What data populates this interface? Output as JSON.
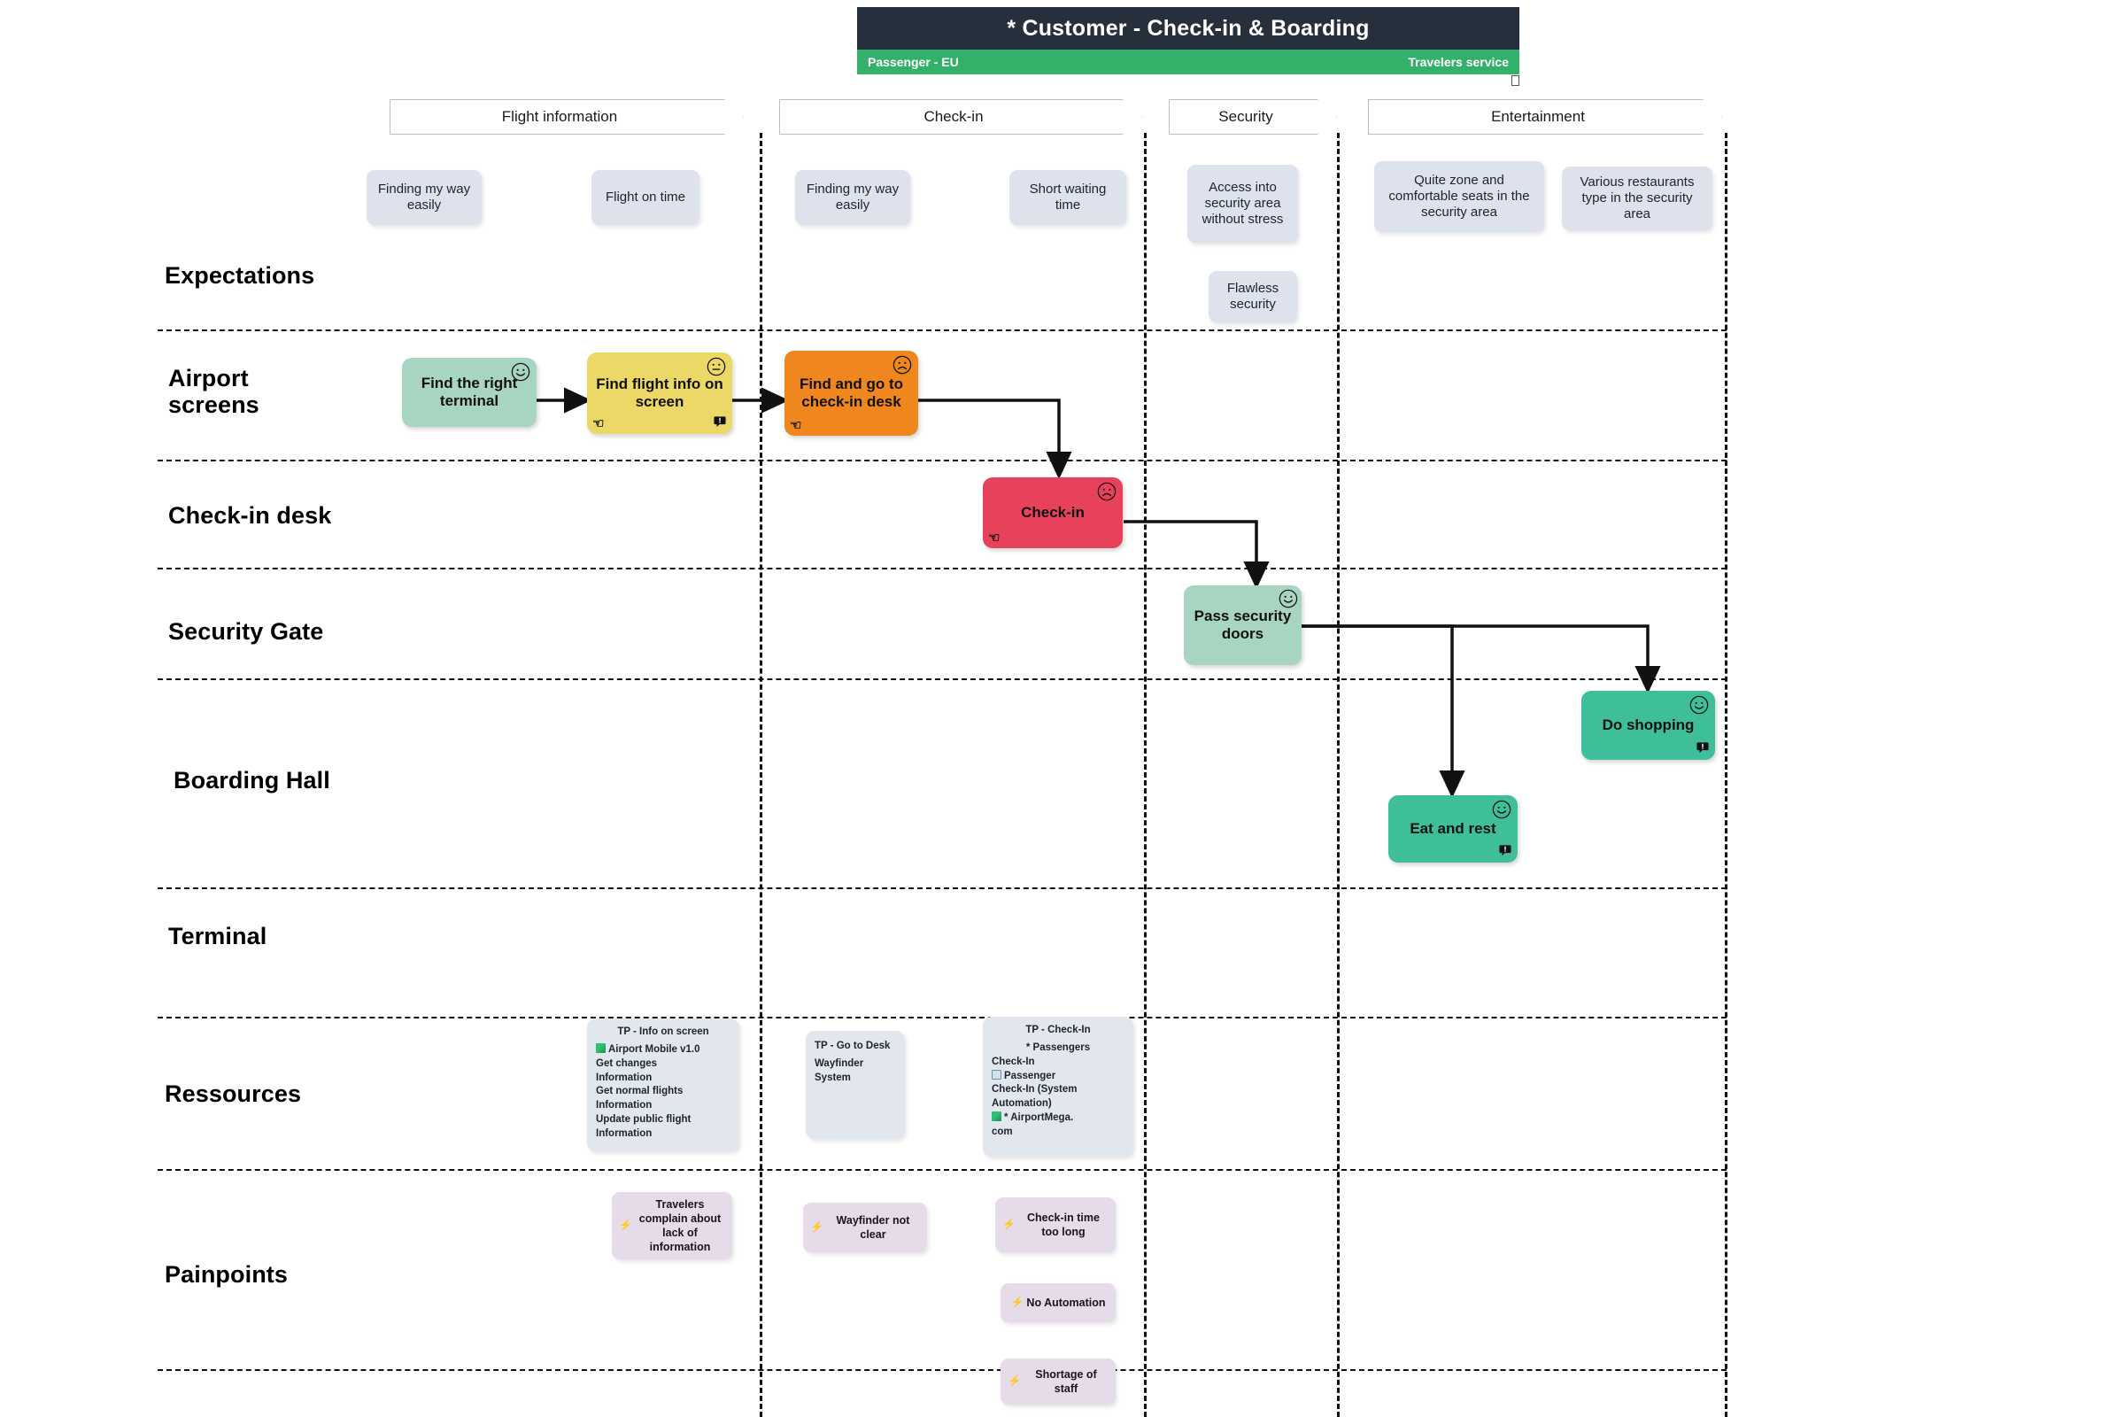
{
  "header": {
    "title": "* Customer - Check-in & Boarding",
    "persona": "Passenger - EU",
    "service": "Travelers service"
  },
  "phases": [
    {
      "label": "Flight information"
    },
    {
      "label": "Check-in"
    },
    {
      "label": "Security"
    },
    {
      "label": "Entertainment"
    }
  ],
  "rows": [
    {
      "label": "Expectations"
    },
    {
      "label": "Airport\nscreens"
    },
    {
      "label": "Check-in desk"
    },
    {
      "label": "Security Gate"
    },
    {
      "label": "Boarding Hall"
    },
    {
      "label": "Terminal"
    },
    {
      "label": "Ressources"
    },
    {
      "label": "Painpoints"
    }
  ],
  "row_labels": {
    "expectations": "Expectations",
    "airport_screens_1": "Airport",
    "airport_screens_2": "screens",
    "checkin_desk": "Check-in desk",
    "security_gate": "Security Gate",
    "boarding_hall": "Boarding Hall",
    "terminal": "Terminal",
    "ressources": "Ressources",
    "painpoints": "Painpoints"
  },
  "expectations": [
    {
      "text": "Finding my way easily",
      "phase": "Flight information"
    },
    {
      "text": "Flight on time",
      "phase": "Flight information"
    },
    {
      "text": "Finding my way easily",
      "phase": "Check-in"
    },
    {
      "text": "Short waiting time",
      "phase": "Check-in"
    },
    {
      "text": "Access into security area without stress",
      "phase": "Security"
    },
    {
      "text": "Flawless security",
      "phase": "Security"
    },
    {
      "text": "Quite zone and comfortable seats in the security area",
      "phase": "Entertainment"
    },
    {
      "text": "Various restaurants type in the security area",
      "phase": "Entertainment"
    }
  ],
  "steps": [
    {
      "label": "Find the right terminal",
      "row": "Airport screens",
      "phase": "Flight information",
      "color": "#a8d5c2",
      "sentiment": "happy",
      "has_hand": false,
      "has_comment": false
    },
    {
      "label": "Find flight info on screen",
      "row": "Airport screens",
      "phase": "Flight information",
      "color": "#ecd867",
      "sentiment": "neutral",
      "has_hand": true,
      "has_comment": true
    },
    {
      "label": "Find and go to check-in desk",
      "row": "Airport screens",
      "phase": "Check-in",
      "color": "#f0871e",
      "sentiment": "sad",
      "has_hand": true,
      "has_comment": false
    },
    {
      "label": "Check-in",
      "row": "Check-in desk",
      "phase": "Check-in",
      "color": "#e8415c",
      "sentiment": "sad",
      "has_hand": true,
      "has_comment": false
    },
    {
      "label": "Pass security doors",
      "row": "Security Gate",
      "phase": "Security",
      "color": "#a8d5c2",
      "sentiment": "happy",
      "has_hand": false,
      "has_comment": false
    },
    {
      "label": "Do shopping",
      "row": "Boarding Hall",
      "phase": "Entertainment",
      "color": "#3fbf99",
      "sentiment": "happy",
      "has_hand": false,
      "has_comment": true
    },
    {
      "label": "Eat and rest",
      "row": "Boarding Hall",
      "phase": "Entertainment",
      "color": "#3fbf99",
      "sentiment": "happy",
      "has_hand": false,
      "has_comment": true
    }
  ],
  "ressources": [
    {
      "phase": "Flight information",
      "title": "TP - Info on screen",
      "lines": [
        {
          "icon": "chart-icon",
          "text": "Airport  Mobile  v1.0"
        },
        {
          "icon": null,
          "text": "Get changes"
        },
        {
          "icon": null,
          "text": "Information"
        },
        {
          "icon": null,
          "text": "Get normal flights"
        },
        {
          "icon": null,
          "text": "Information"
        },
        {
          "icon": null,
          "text": "Update public flight"
        },
        {
          "icon": null,
          "text": "Information"
        }
      ]
    },
    {
      "phase": "Check-in",
      "title": "TP - Go to Desk",
      "lines": [
        {
          "icon": null,
          "text": "Wayfinder"
        },
        {
          "icon": null,
          "text": "System"
        }
      ]
    },
    {
      "phase": "Check-in",
      "title": "TP - Check-In",
      "lines": [
        {
          "icon": null,
          "text": "* Passengers"
        },
        {
          "icon": null,
          "text": "Check-In"
        },
        {
          "icon": "box-icon",
          "text": "Passenger"
        },
        {
          "icon": null,
          "text": "Check-In (System"
        },
        {
          "icon": null,
          "text": "Automation)"
        },
        {
          "icon": "chart-icon",
          "text": "* AirportMega."
        },
        {
          "icon": null,
          "text": "com"
        }
      ]
    }
  ],
  "painpoints": [
    {
      "text": "Travelers complain about lack of information",
      "phase": "Flight information"
    },
    {
      "text": "Wayfinder not clear",
      "phase": "Check-in"
    },
    {
      "text": "Check-in time too long",
      "phase": "Check-in"
    },
    {
      "text": "No Automation",
      "phase": "Check-in"
    },
    {
      "text": "Shortage of staff",
      "phase": "Check-in"
    }
  ],
  "icons": {
    "bolt": "⚡",
    "hand": "☟",
    "comment": "💬",
    "happy": "happy-face-icon",
    "neutral": "neutral-face-icon",
    "sad": "sad-face-icon"
  },
  "colors": {
    "header_bg": "#26303d",
    "persona_bg": "#33b06a",
    "expectation_card": "#dde2ec",
    "resource_card": "#e2e7ee",
    "painpoint_card": "#e6dbe8",
    "green_light": "#a8d5c2",
    "yellow": "#ecd867",
    "orange": "#f0871e",
    "red": "#e8415c",
    "teal": "#3fbf99"
  }
}
